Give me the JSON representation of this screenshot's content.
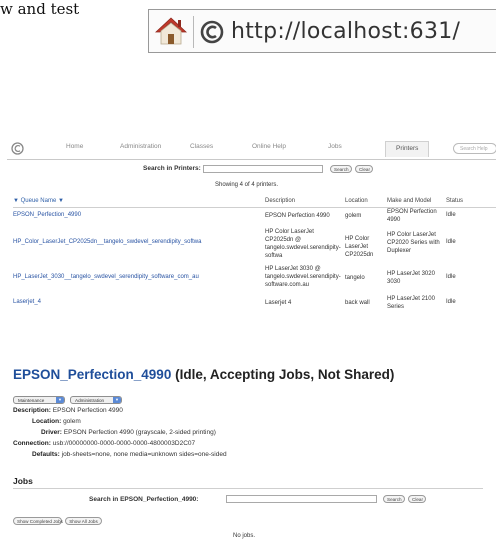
{
  "doc_fragment": "w and test",
  "urlbar": {
    "url": "http://localhost:631/"
  },
  "tabs": [
    {
      "label": "Home"
    },
    {
      "label": "Administration"
    },
    {
      "label": "Classes"
    },
    {
      "label": "Online Help"
    },
    {
      "label": "Jobs"
    },
    {
      "label": "Printers"
    }
  ],
  "tab_search_placeholder": "Search Help",
  "printers_search": {
    "label": "Search in Printers:",
    "search_button": "Search",
    "clear_button": "Clear"
  },
  "showing_text": "Showing 4 of 4 printers.",
  "table": {
    "headers": {
      "queue": "▼ Queue Name ▼",
      "description": "Description",
      "location": "Location",
      "model": "Make and Model",
      "status": "Status"
    },
    "rows": [
      {
        "queue": "EPSON_Perfection_4990",
        "description": "EPSON Perfection 4990",
        "location": "golem",
        "model": "EPSON Perfection 4990",
        "status": "Idle"
      },
      {
        "queue": "HP_Color_LaserJet_CP2025dn__tangelo_swdevel_serendipity_softwa",
        "description": "HP Color LaserJet CP2025dn @ tangelo.swdevel.serendipity-softwa",
        "location": "HP Color LaserJet CP2025dn",
        "model": "HP Color LaserJet CP2020 Series with Duplexer",
        "status": "Idle"
      },
      {
        "queue": "HP_LaserJet_3030__tangelo_swdevel_serendipity_software_com_au",
        "description": "HP LaserJet 3030 @ tangelo.swdevel.serendipity-software.com.au",
        "location": "tangelo",
        "model": "HP LaserJet 3020 3030",
        "status": "Idle"
      },
      {
        "queue": "Laserjet_4",
        "description": "Laserjet 4",
        "location": "back wall",
        "model": "HP LaserJet 2100 Series",
        "status": "Idle"
      }
    ]
  },
  "detail": {
    "printer_name": "EPSON_Perfection_4990",
    "state": "(Idle, Accepting Jobs, Not Shared)",
    "maintenance_select": "Maintenance",
    "administration_select": "Administration",
    "fields": [
      {
        "key": "Description:",
        "value": "EPSON Perfection 4990"
      },
      {
        "key": "Location:",
        "value": "golem"
      },
      {
        "key": "Driver:",
        "value": "EPSON Perfection 4990 (grayscale, 2-sided printing)"
      },
      {
        "key": "Connection:",
        "value": "usb://00000000-0000-0000-0000-4800003D2C07"
      },
      {
        "key": "Defaults:",
        "value": "job-sheets=none, none media=unknown sides=one-sided"
      }
    ]
  },
  "jobs": {
    "heading": "Jobs",
    "search_label": "Search in EPSON_Perfection_4990:",
    "search_button": "Search",
    "clear_button": "Clear",
    "show_completed": "Show Completed Jobs",
    "show_all": "Show All Jobs",
    "empty_text": "No jobs."
  },
  "colors": {
    "link_blue": "#2853a3",
    "title_blue": "#1f4e9a",
    "roof_red": "#c0392b"
  }
}
